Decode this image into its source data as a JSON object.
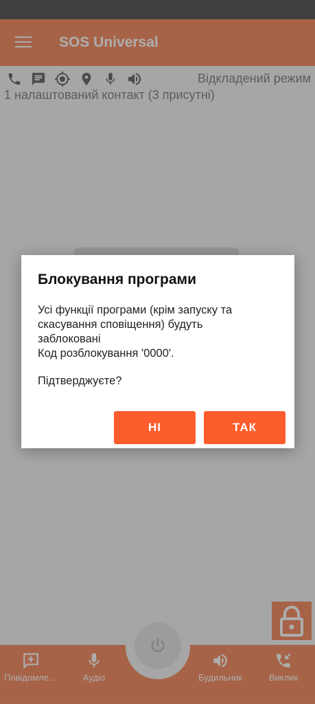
{
  "app_bar": {
    "title": "SOS Universal"
  },
  "status": {
    "mode_text": "Відкладений режим",
    "contacts_text": "1 налаштований контакт (3 присутні)",
    "icons": [
      "phone-icon",
      "message-icon",
      "gps-icon",
      "location-pin-icon",
      "microphone-icon",
      "speaker-icon"
    ]
  },
  "bottom_nav": {
    "items": [
      {
        "label": "Повідомле…",
        "icon": "add-message-icon"
      },
      {
        "label": "Аудіо",
        "icon": "microphone-icon"
      },
      {
        "label": "Будильник",
        "icon": "speaker-icon"
      },
      {
        "label": "Виклик",
        "icon": "incoming-call-icon"
      }
    ]
  },
  "dialog": {
    "title": "Блокування програми",
    "message_line1": "Усі функції програми (крім запуску та скасування сповіщення) будуть заблоковані",
    "message_line2": "Код розблокування '0000'.",
    "question": "Підтверджуєте?",
    "no_label": "НІ",
    "yes_label": "ТАК"
  },
  "colors": {
    "app_bar": "#f7936a",
    "accent_button": "#fd5c2c",
    "status_bar": "#5f5f5f",
    "background": "#f5f5f5"
  }
}
